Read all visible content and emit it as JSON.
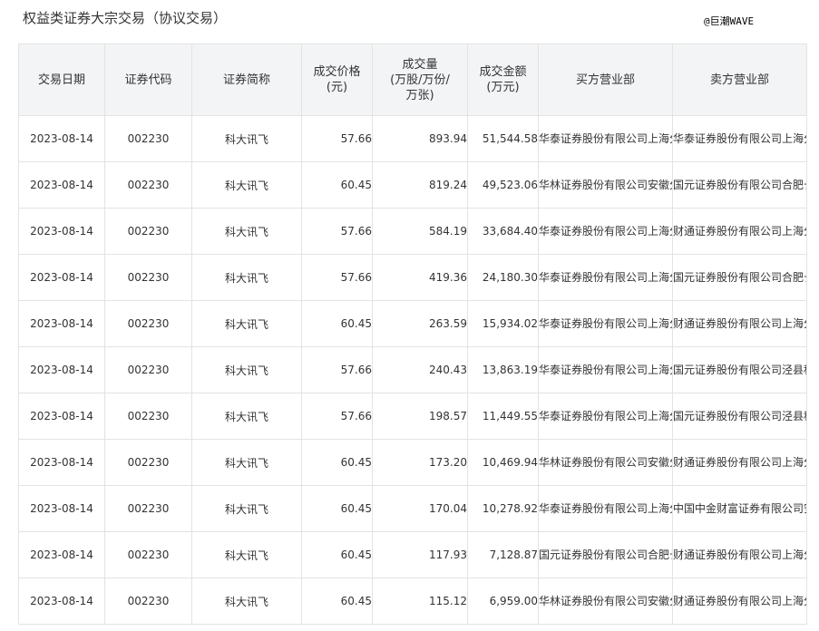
{
  "page": {
    "title": "权益类证券大宗交易（协议交易）",
    "watermark": "@巨潮WAVE"
  },
  "table": {
    "headers": [
      "交易日期",
      "证券代码",
      "证券简称",
      "成交价格\n(元)",
      "成交量\n(万股/万份/\n万张)",
      "成交金额\n(万元)",
      "买方营业部",
      "卖方营业部"
    ],
    "rows": [
      [
        "2023-08-14",
        "002230",
        "科大讯飞",
        "57.66",
        "893.94",
        "51,544.58",
        "华泰证券股份有限公司上海分公司",
        "华泰证券股份有限公司上海分公司"
      ],
      [
        "2023-08-14",
        "002230",
        "科大讯飞",
        "60.45",
        "819.24",
        "49,523.06",
        "华林证券股份有限公司安徽分公司",
        "国元证券股份有限公司合肥长江路证券营业部"
      ],
      [
        "2023-08-14",
        "002230",
        "科大讯飞",
        "57.66",
        "584.19",
        "33,684.40",
        "华泰证券股份有限公司上海分公司",
        "财通证券股份有限公司上海分公司"
      ],
      [
        "2023-08-14",
        "002230",
        "科大讯飞",
        "57.66",
        "419.36",
        "24,180.30",
        "华泰证券股份有限公司上海分公司",
        "国元证券股份有限公司合肥长江路证券营业部"
      ],
      [
        "2023-08-14",
        "002230",
        "科大讯飞",
        "60.45",
        "263.59",
        "15,934.02",
        "华泰证券股份有限公司上海分公司",
        "财通证券股份有限公司上海分公司"
      ],
      [
        "2023-08-14",
        "002230",
        "科大讯飞",
        "57.66",
        "240.43",
        "13,863.19",
        "华泰证券股份有限公司上海分公司",
        "国元证券股份有限公司泾县种墨园路证券营业部"
      ],
      [
        "2023-08-14",
        "002230",
        "科大讯飞",
        "57.66",
        "198.57",
        "11,449.55",
        "华泰证券股份有限公司上海分公司",
        "国元证券股份有限公司泾县种墨园路证券营业部"
      ],
      [
        "2023-08-14",
        "002230",
        "科大讯飞",
        "60.45",
        "173.20",
        "10,469.94",
        "华林证券股份有限公司安徽分公司",
        "财通证券股份有限公司上海分公司"
      ],
      [
        "2023-08-14",
        "002230",
        "科大讯飞",
        "60.45",
        "170.04",
        "10,278.92",
        "华泰证券股份有限公司上海分公司",
        "中国中金财富证券有限公司安徽分公司"
      ],
      [
        "2023-08-14",
        "002230",
        "科大讯飞",
        "60.45",
        "117.93",
        "7,128.87",
        "国元证券股份有限公司合肥长江路证券营业部",
        "财通证券股份有限公司上海分公司"
      ],
      [
        "2023-08-14",
        "002230",
        "科大讯飞",
        "60.45",
        "115.12",
        "6,959.00",
        "华林证券股份有限公司安徽分公司",
        "财通证券股份有限公司上海分公司"
      ]
    ]
  }
}
